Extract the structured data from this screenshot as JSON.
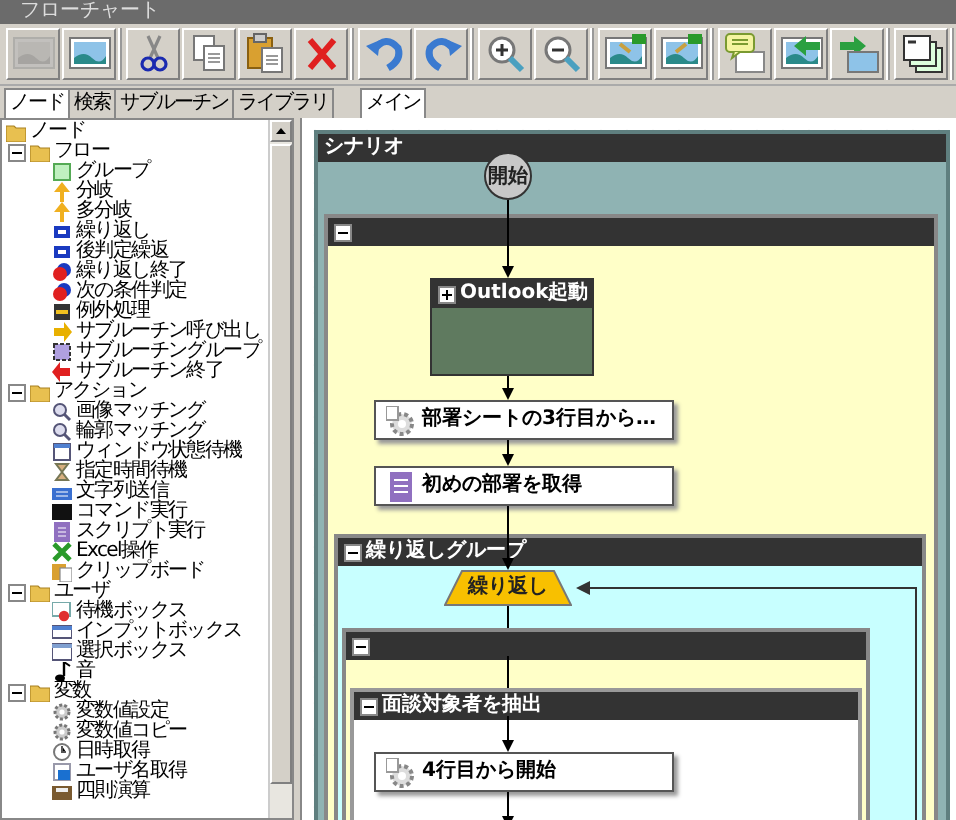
{
  "window": {
    "title": "フローチャート"
  },
  "toolbar": [
    {
      "buttons": [
        {
          "kind": "picture",
          "disabled": true
        },
        {
          "kind": "picture",
          "disabled": false
        }
      ]
    },
    {
      "buttons": [
        {
          "kind": "cut",
          "disabled": false
        },
        {
          "kind": "copy",
          "disabled": false
        },
        {
          "kind": "paste",
          "disabled": false
        },
        {
          "kind": "delete",
          "disabled": false
        }
      ]
    },
    {
      "buttons": [
        {
          "kind": "undo",
          "disabled": false
        },
        {
          "kind": "redo",
          "disabled": false
        }
      ]
    },
    {
      "buttons": [
        {
          "kind": "zoom_in",
          "disabled": false
        },
        {
          "kind": "zoom_out",
          "disabled": false
        }
      ]
    },
    {
      "buttons": [
        {
          "kind": "image_in",
          "disabled": false
        },
        {
          "kind": "image_out",
          "disabled": false
        }
      ]
    },
    {
      "buttons": [
        {
          "kind": "comment",
          "disabled": false
        },
        {
          "kind": "move_left",
          "disabled": false
        },
        {
          "kind": "move_right",
          "disabled": false
        }
      ]
    },
    {
      "buttons": [
        {
          "kind": "windows",
          "disabled": false
        }
      ]
    }
  ],
  "left_tabs": [
    {
      "label": "ノード",
      "selected": true
    },
    {
      "label": "検索",
      "selected": false
    },
    {
      "label": "サブルーチン",
      "selected": false
    },
    {
      "label": "ライブラリ",
      "selected": false
    }
  ],
  "tree": {
    "label": "ノード",
    "kind": "folder",
    "children": [
      {
        "label": "フロー",
        "kind": "folder",
        "expanded": true,
        "children": [
          {
            "label": "グループ",
            "kind": "group"
          },
          {
            "label": "分岐",
            "kind": "branch"
          },
          {
            "label": "多分岐",
            "kind": "branch"
          },
          {
            "label": "繰り返し",
            "kind": "loop"
          },
          {
            "label": "後判定繰返",
            "kind": "loop"
          },
          {
            "label": "繰り返し終了",
            "kind": "loop_end"
          },
          {
            "label": "次の条件判定",
            "kind": "loop_end"
          },
          {
            "label": "例外処理",
            "kind": "exception"
          },
          {
            "label": "サブルーチン呼び出し",
            "kind": "sub_call"
          },
          {
            "label": "サブルーチングループ",
            "kind": "sub_group"
          },
          {
            "label": "サブルーチン終了",
            "kind": "sub_end"
          }
        ]
      },
      {
        "label": "アクション",
        "kind": "folder",
        "expanded": true,
        "children": [
          {
            "label": "画像マッチング",
            "kind": "magnifier"
          },
          {
            "label": "輪郭マッチング",
            "kind": "magnifier"
          },
          {
            "label": "ウィンドウ状態待機",
            "kind": "window"
          },
          {
            "label": "指定時間待機",
            "kind": "hourglass"
          },
          {
            "label": "文字列送信",
            "kind": "keyboard"
          },
          {
            "label": "コマンド実行",
            "kind": "terminal"
          },
          {
            "label": "スクリプト実行",
            "kind": "script"
          },
          {
            "label": "Excel操作",
            "kind": "excel"
          },
          {
            "label": "クリップボード",
            "kind": "clipboard"
          }
        ]
      },
      {
        "label": "ユーザ",
        "kind": "folder",
        "expanded": true,
        "children": [
          {
            "label": "待機ボックス",
            "kind": "dialog"
          },
          {
            "label": "インプットボックス",
            "kind": "input_box"
          },
          {
            "label": "選択ボックス",
            "kind": "list_box"
          },
          {
            "label": "音",
            "kind": "note"
          }
        ]
      },
      {
        "label": "変数",
        "kind": "folder",
        "expanded": true,
        "children": [
          {
            "label": "変数値設定",
            "kind": "gear"
          },
          {
            "label": "変数値コピー",
            "kind": "gear"
          },
          {
            "label": "日時取得",
            "kind": "clock"
          },
          {
            "label": "ユーザ名取得",
            "kind": "card"
          },
          {
            "label": "四則演算",
            "kind": "calculator"
          }
        ]
      }
    ]
  },
  "canvas_tabs": [
    {
      "label": "メイン",
      "selected": true
    }
  ],
  "scenario": {
    "title": "シナリオ",
    "start": "開始",
    "group": {
      "expanded": true,
      "nodes": [
        {
          "kind": "subflow",
          "title": "Outlook起動",
          "expanded": false
        },
        {
          "kind": "gear_action",
          "label": "部署シートの3行目から…"
        },
        {
          "kind": "script_action",
          "label": "初めの部署を取得"
        }
      ],
      "loop_group": {
        "title": "繰り返しグループ",
        "expanded": true,
        "loop_label": "繰り返し",
        "body": {
          "expanded": true,
          "group": {
            "title": "面談対象者を抽出",
            "expanded": true,
            "nodes": [
              {
                "kind": "gear_action",
                "label": "4行目から開始"
              }
            ]
          }
        }
      }
    }
  }
}
